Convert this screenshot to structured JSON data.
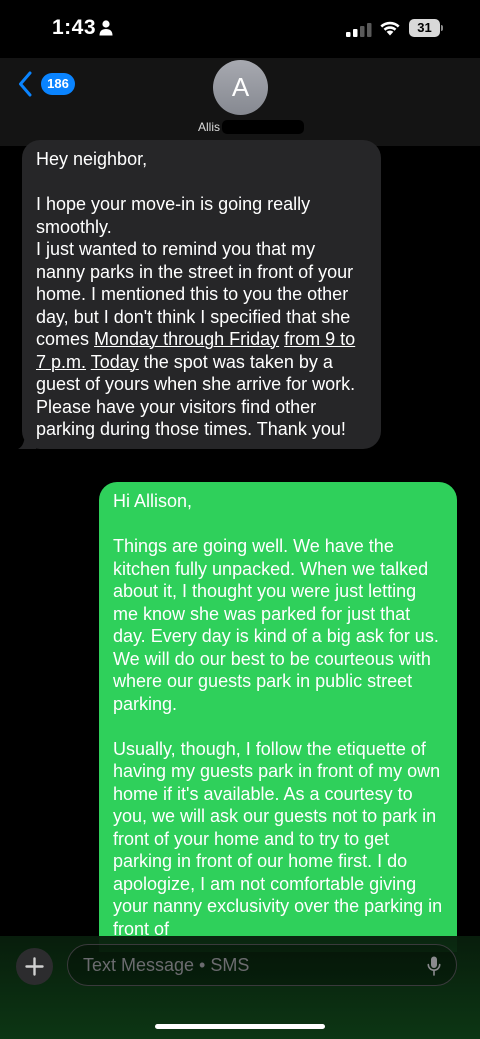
{
  "status_bar": {
    "time": "1:43",
    "battery_level": "31"
  },
  "header": {
    "unread_count": "186",
    "avatar_initial": "A",
    "contact_name_visible": "Allis"
  },
  "messages": {
    "received": {
      "greeting": "Hey neighbor,",
      "p1": "I hope your move-in is going really smoothly.",
      "p2_before": "I just wanted to remind you that my nanny parks in the street in front of your home. I mentioned this to you the other day, but I don't think I specified that she comes ",
      "p2_link1": "Monday through Friday",
      "p2_mid": " ",
      "p2_link2": "from 9 to 7 p.m.",
      "p2_space": " ",
      "p2_link3": "Today",
      "p2_after": " the spot was taken by a guest of yours when she arrive for work.  Please have your visitors find other parking during those times. Thank you!"
    },
    "sent": {
      "greeting": "Hi Allison,",
      "p1": "Things are going well. We have the kitchen fully unpacked. When we talked about it, I thought you were just letting me know she was parked for just that day. Every day is kind of a big ask for us. We will do our best to be courteous with where our guests park in public street parking.",
      "p2": "Usually, though, I follow the etiquette of having my guests park in front of my own home if it's available. As a courtesy to you, we will ask our guests not to park in front of your home and to try to get parking in front of our home first. I do apologize, I am not comfortable giving your nanny exclusivity over the parking in front of"
    }
  },
  "input": {
    "placeholder": "Text Message • SMS"
  },
  "icons": {
    "back": "chevron-left-icon",
    "plus": "plus-icon",
    "mic": "microphone-icon",
    "signal": "cellular-signal-icon",
    "wifi": "wifi-icon",
    "battery": "battery-icon",
    "person": "person-icon"
  },
  "colors": {
    "accent_blue": "#0a84ff",
    "sent_bubble": "#2fd05b",
    "received_bubble": "#262628",
    "background": "#000000"
  }
}
